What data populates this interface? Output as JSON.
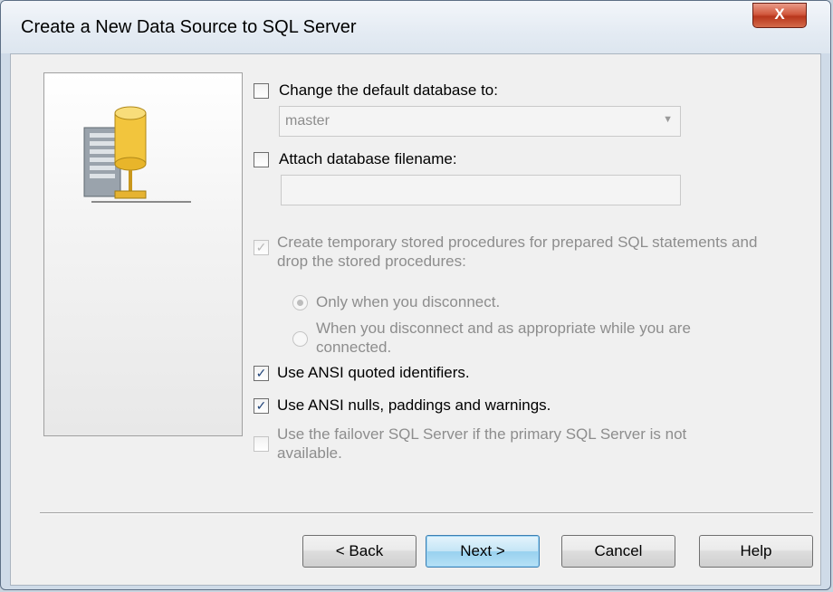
{
  "window": {
    "title": "Create a New Data Source to SQL Server",
    "close_label": "X"
  },
  "options": {
    "change_default_db": {
      "label": "Change the default database to:",
      "checked": false
    },
    "default_db_combo": {
      "value": "master"
    },
    "attach_filename": {
      "label": "Attach database filename:",
      "checked": false
    },
    "attach_filename_input": {
      "value": ""
    },
    "create_temp_procs": {
      "label_line1": "Create temporary stored procedures for prepared SQL statements and",
      "label_line2": "drop the stored procedures:",
      "checked": true,
      "enabled": false
    },
    "radio_disconnect": {
      "label": "Only when you disconnect.",
      "selected": true
    },
    "radio_appropriate": {
      "label_line1": "When you disconnect and as appropriate while you are",
      "label_line2": "connected.",
      "selected": false
    },
    "ansi_quoted": {
      "label": "Use ANSI quoted identifiers.",
      "checked": true
    },
    "ansi_nulls": {
      "label": "Use ANSI nulls, paddings and warnings.",
      "checked": true
    },
    "failover": {
      "label_line1": "Use the failover SQL Server if the primary SQL Server is not",
      "label_line2": "available.",
      "checked": false,
      "enabled": false
    }
  },
  "buttons": {
    "back": "< Back",
    "next": "Next >",
    "cancel": "Cancel",
    "help": "Help"
  },
  "icons": {
    "sidebar": "database-server-icon",
    "checkmark": "✓"
  }
}
